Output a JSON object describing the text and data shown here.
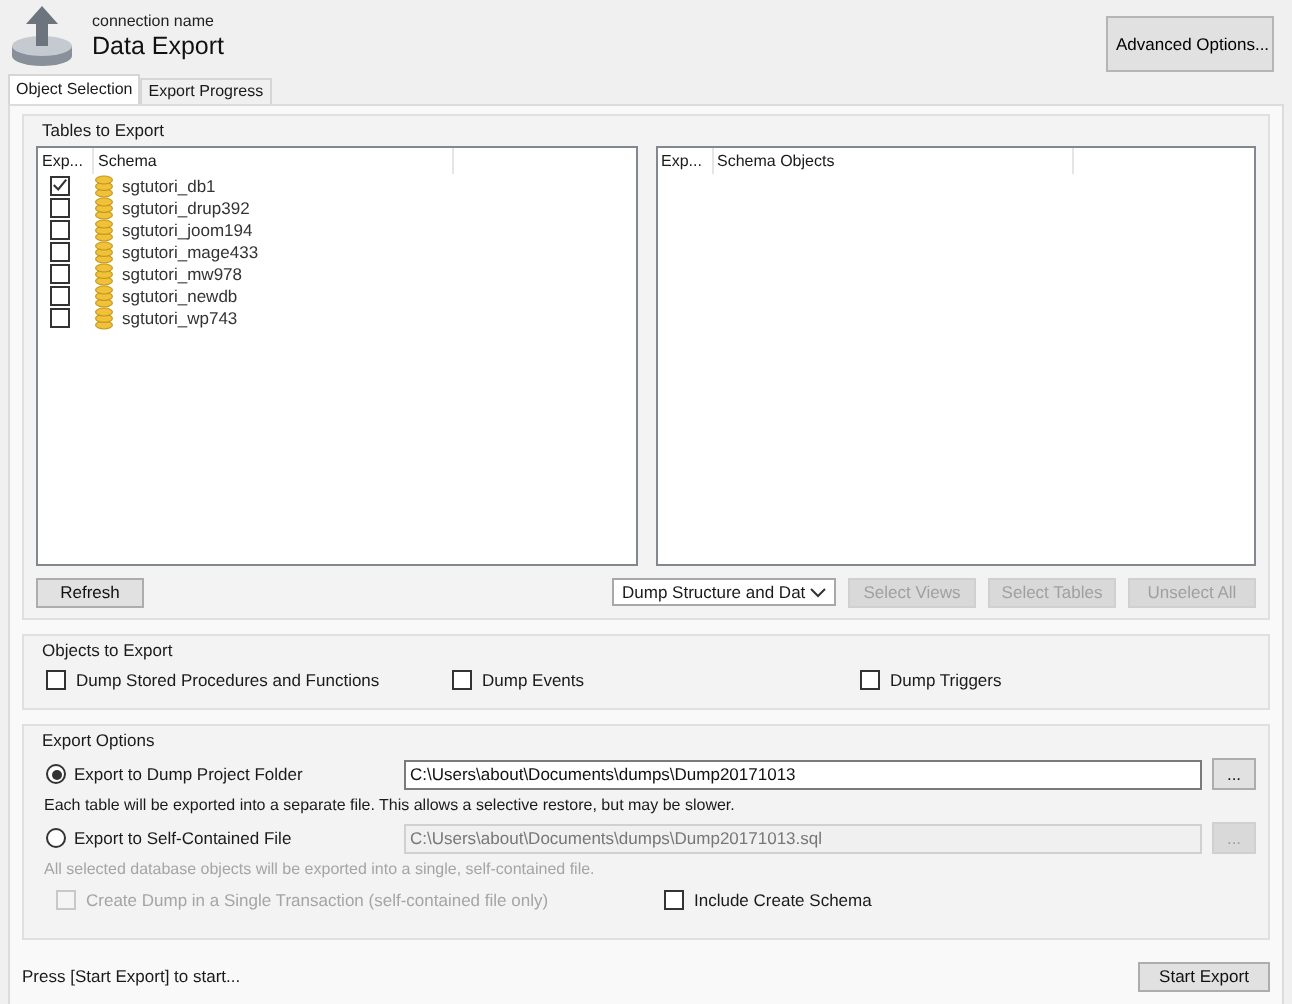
{
  "header": {
    "subtitle": "connection name",
    "title": "Data Export",
    "advanced_button": "Advanced Options..."
  },
  "tabs": [
    {
      "label": "Object Selection",
      "selected": true
    },
    {
      "label": "Export Progress",
      "selected": false
    }
  ],
  "tables_group": {
    "title": "Tables to Export",
    "schema_list": {
      "columns": [
        "Exp...",
        "Schema"
      ],
      "rows": [
        {
          "name": "sgtutori_db1",
          "checked": true
        },
        {
          "name": "sgtutori_drup392",
          "checked": false
        },
        {
          "name": "sgtutori_joom194",
          "checked": false
        },
        {
          "name": "sgtutori_mage433",
          "checked": false
        },
        {
          "name": "sgtutori_mw978",
          "checked": false
        },
        {
          "name": "sgtutori_newdb",
          "checked": false
        },
        {
          "name": "sgtutori_wp743",
          "checked": false
        }
      ]
    },
    "objects_list": {
      "columns": [
        "Exp...",
        "Schema Objects"
      ]
    },
    "refresh_button": "Refresh",
    "dump_select": {
      "value": "Dump Structure and Dat"
    },
    "buttons": [
      {
        "label": "Select Views",
        "disabled": true
      },
      {
        "label": "Select Tables",
        "disabled": true
      },
      {
        "label": "Unselect All",
        "disabled": true
      }
    ]
  },
  "objects_group": {
    "title": "Objects to Export",
    "options": [
      {
        "label": "Dump Stored Procedures and Functions",
        "checked": false
      },
      {
        "label": "Dump Events",
        "checked": false
      },
      {
        "label": "Dump Triggers",
        "checked": false
      }
    ]
  },
  "export_options": {
    "title": "Export Options",
    "modes": [
      {
        "label": "Export to Dump Project Folder",
        "selected": true,
        "path": "C:\\Users\\about\\Documents\\dumps\\Dump20171013",
        "browse": "...",
        "note": "Each table will be exported into a separate file. This allows a selective restore, but may be slower."
      },
      {
        "label": "Export to Self-Contained File",
        "selected": false,
        "path": "C:\\Users\\about\\Documents\\dumps\\Dump20171013.sql",
        "browse": "...",
        "note": "All selected database objects will be exported into a single, self-contained file."
      }
    ],
    "single_transaction": {
      "label": "Create Dump in a Single Transaction (self-contained file only)",
      "checked": false,
      "disabled": true
    },
    "include_schema": {
      "label": "Include Create Schema",
      "checked": false,
      "disabled": false
    }
  },
  "status_bar": {
    "text": "Press [Start Export] to start...",
    "start_button": "Start Export"
  }
}
